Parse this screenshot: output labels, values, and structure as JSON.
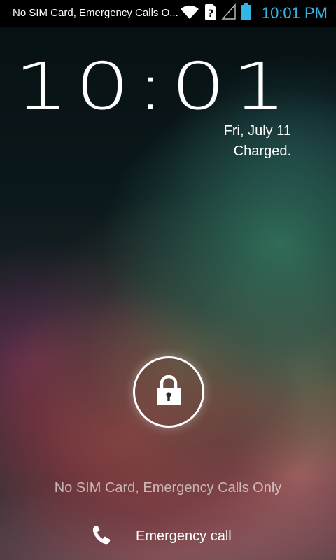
{
  "status_bar": {
    "carrier_text": "No SIM Card, Emergency Calls O...",
    "time": "10:01 PM",
    "icons": [
      "wifi-icon",
      "no-sim-icon",
      "signal-icon",
      "battery-icon"
    ],
    "time_color": "#33b5e5"
  },
  "lockscreen": {
    "clock": "10:01",
    "date": "Fri, July 11",
    "charge_status": "Charged.",
    "lock_icon": "padlock-icon",
    "carrier_message": "No SIM Card, Emergency Calls Only",
    "emergency_call_label": "Emergency call",
    "emergency_icon": "phone-icon"
  }
}
